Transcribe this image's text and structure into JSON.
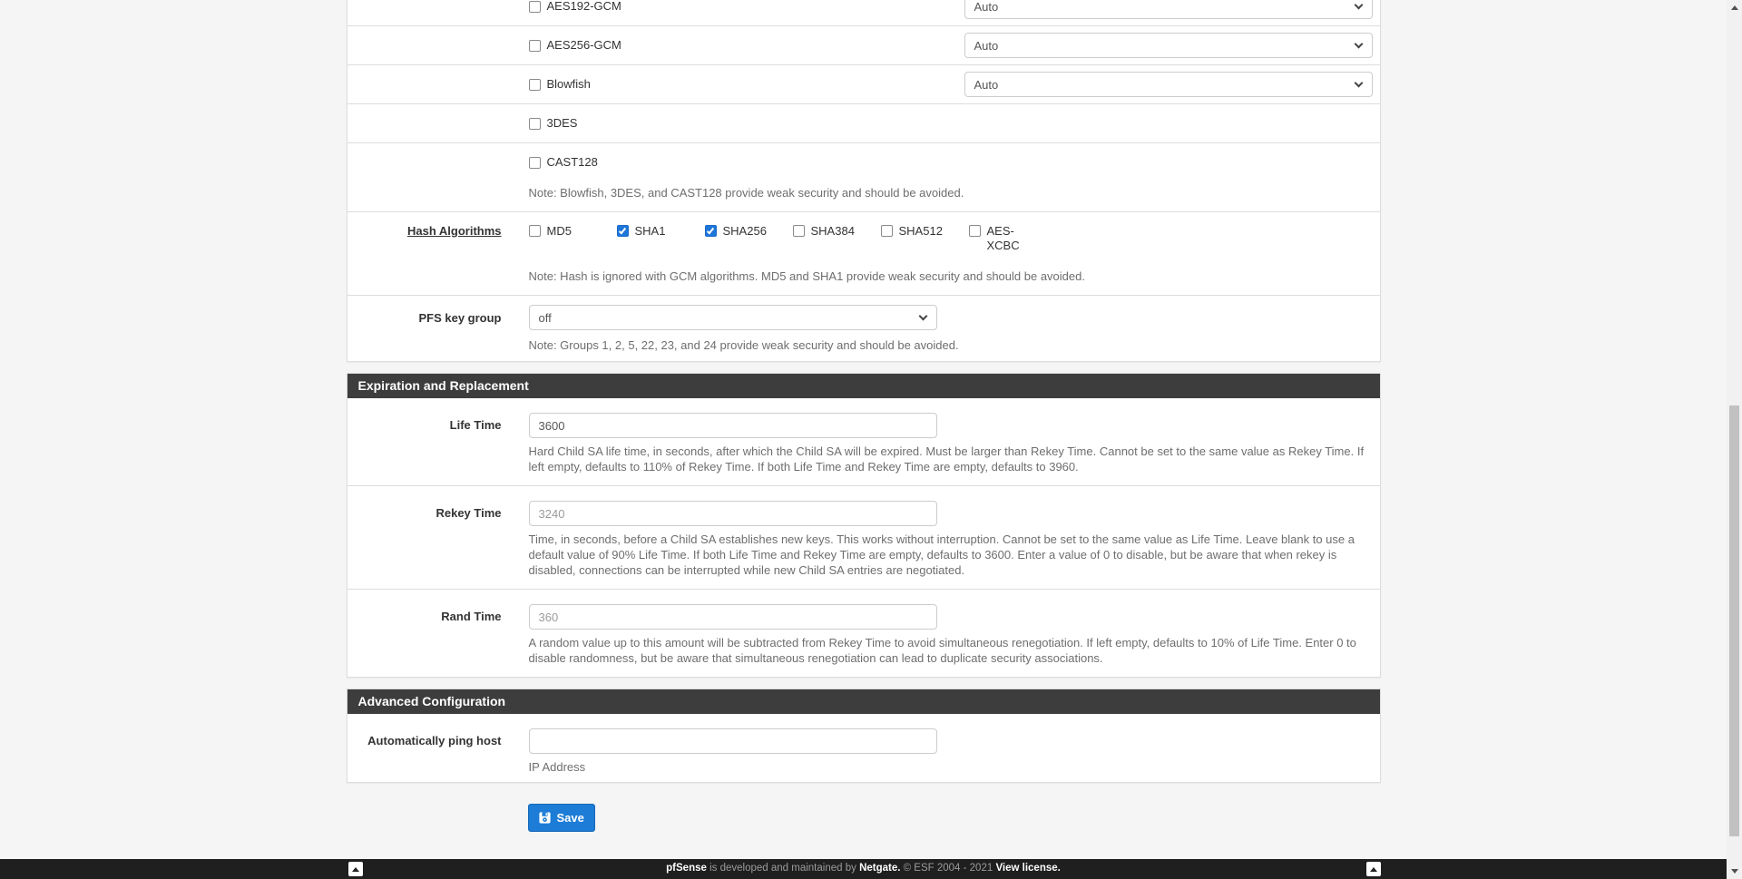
{
  "encryption_section": {
    "rows": [
      {
        "label": "AES192-GCM",
        "checked": false,
        "has_select": true,
        "select_value": "Auto"
      },
      {
        "label": "AES256-GCM",
        "checked": false,
        "has_select": true,
        "select_value": "Auto"
      },
      {
        "label": "Blowfish",
        "checked": false,
        "has_select": true,
        "select_value": "Auto"
      },
      {
        "label": "3DES",
        "checked": false,
        "has_select": false,
        "select_value": ""
      },
      {
        "label": "CAST128",
        "checked": false,
        "has_select": false,
        "select_value": ""
      }
    ],
    "weak_note": "Note: Blowfish, 3DES, and CAST128 provide weak security and should be avoided."
  },
  "hash_row": {
    "label": "Hash Algorithms",
    "options": [
      {
        "label": "MD5",
        "checked": false
      },
      {
        "label": "SHA1",
        "checked": true
      },
      {
        "label": "SHA256",
        "checked": true
      },
      {
        "label": "SHA384",
        "checked": false
      },
      {
        "label": "SHA512",
        "checked": false
      },
      {
        "label": "AES-XCBC",
        "checked": false
      }
    ],
    "note": "Note: Hash is ignored with GCM algorithms. MD5 and SHA1 provide weak security and should be avoided."
  },
  "pfs_row": {
    "label": "PFS key group",
    "select_value": "off",
    "note": "Note: Groups 1, 2, 5, 22, 23, and 24 provide weak security and should be avoided."
  },
  "expiration_section": {
    "title": "Expiration and Replacement",
    "fields": [
      {
        "label": "Life Time",
        "value": "3600",
        "placeholder": "",
        "help": "Hard Child SA life time, in seconds, after which the Child SA will be expired. Must be larger than Rekey Time. Cannot be set to the same value as Rekey Time. If left empty, defaults to 110% of Rekey Time. If both Life Time and Rekey Time are empty, defaults to 3960."
      },
      {
        "label": "Rekey Time",
        "value": "",
        "placeholder": "3240",
        "help": "Time, in seconds, before a Child SA establishes new keys. This works without interruption. Cannot be set to the same value as Life Time. Leave blank to use a default value of 90% Life Time. If both Life Time and Rekey Time are empty, defaults to 3600. Enter a value of 0 to disable, but be aware that when rekey is disabled, connections can be interrupted while new Child SA entries are negotiated."
      },
      {
        "label": "Rand Time",
        "value": "",
        "placeholder": "360",
        "help": "A random value up to this amount will be subtracted from Rekey Time to avoid simultaneous renegotiation. If left empty, defaults to 10% of Life Time. Enter 0 to disable randomness, but be aware that simultaneous renegotiation can lead to duplicate security associations."
      }
    ]
  },
  "advanced_section": {
    "title": "Advanced Configuration",
    "field": {
      "label": "Automatically ping host",
      "value": "",
      "help": "IP Address"
    }
  },
  "save_button": {
    "label": "Save"
  },
  "footer": {
    "segments": [
      {
        "text": "pfSense"
      },
      {
        "text": " is developed and maintained by "
      },
      {
        "text": "Netgate."
      },
      {
        "text": " © ESF 2004 - 2021 "
      },
      {
        "text": "View license."
      }
    ]
  },
  "colors": {
    "accent_blue": "#1c7cd6",
    "checkbox_blue": "#1e76d9",
    "panel_header_bg": "#3d3d3d",
    "footer_bg": "#1f1f1f"
  }
}
